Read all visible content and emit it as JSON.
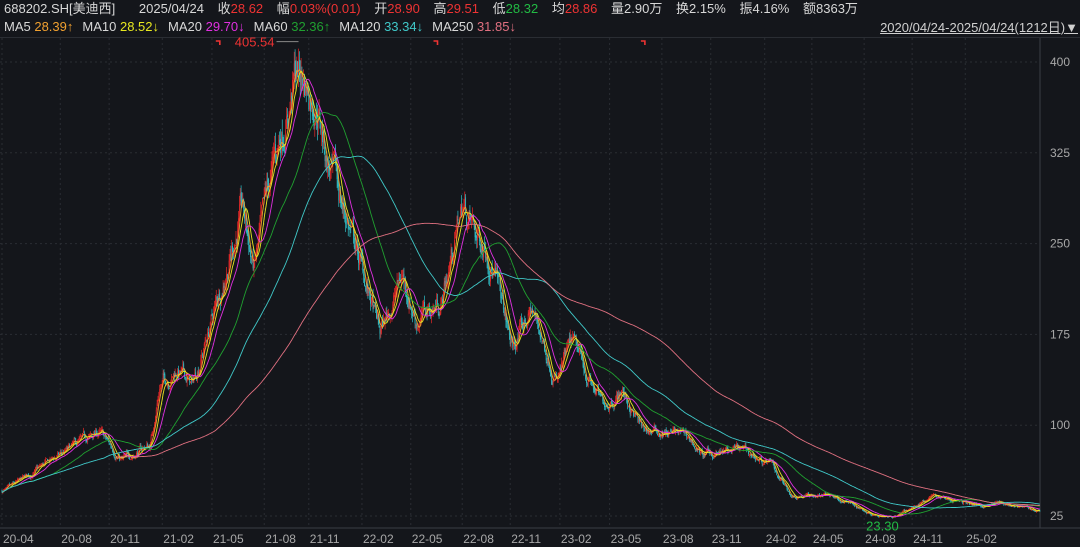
{
  "header": {
    "symbol": "688202.SH[美迪西]",
    "date": "2025/04/24",
    "close_label": "收",
    "close": "28.62",
    "change_label": "幅",
    "change": "0.03%(0.01)",
    "open_label": "开",
    "open": "28.90",
    "high_label": "高",
    "high": "29.51",
    "low_label": "低",
    "low": "28.32",
    "avg_label": "均",
    "avg": "28.86",
    "volume_label": "量",
    "volume": "2.90万",
    "turnover_label": "换",
    "turnover": "2.15%",
    "amplitude_label": "振",
    "amplitude": "4.16%",
    "amount_label": "额",
    "amount": "8363万",
    "range": "2020/04/24-2025/04/24(1212日)",
    "range_icon": "triangle-down-icon"
  },
  "ma": [
    {
      "name": "MA5",
      "value": "28.39↑",
      "color": "#f0a030",
      "period": 5
    },
    {
      "name": "MA10",
      "value": "28.52↓",
      "color": "#e8e820",
      "period": 10
    },
    {
      "name": "MA20",
      "value": "29.70↓",
      "color": "#e030e0",
      "period": 20
    },
    {
      "name": "MA60",
      "value": "32.36↑",
      "color": "#20a030",
      "period": 60
    },
    {
      "name": "MA120",
      "value": "33.34↓",
      "color": "#40c8c8",
      "period": 120
    },
    {
      "name": "MA250",
      "value": "31.85↓",
      "color": "#e07080",
      "period": 250
    }
  ],
  "colors": {
    "up": "#e82828",
    "down": "#30c0c8",
    "grid": "#2a2d33",
    "background": "#14161b"
  },
  "chart_data": {
    "type": "candlestick",
    "title": "688202.SH[美迪西] daily",
    "total_days": 1212,
    "ylim": [
      25,
      400
    ],
    "y_ticks": [
      25,
      100,
      175,
      250,
      325,
      400
    ],
    "y_tick_labels": [
      "25",
      "100",
      "175",
      "250",
      "325",
      "400"
    ],
    "x_ticks": [
      {
        "label": "20-04",
        "day": 0
      },
      {
        "label": "20-08",
        "day": 68
      },
      {
        "label": "20-11",
        "day": 125
      },
      {
        "label": "21-02",
        "day": 187
      },
      {
        "label": "21-05",
        "day": 245
      },
      {
        "label": "21-08",
        "day": 306
      },
      {
        "label": "21-11",
        "day": 358
      },
      {
        "label": "22-02",
        "day": 420
      },
      {
        "label": "22-05",
        "day": 477
      },
      {
        "label": "22-08",
        "day": 537
      },
      {
        "label": "22-11",
        "day": 593
      },
      {
        "label": "23-02",
        "day": 651
      },
      {
        "label": "23-05",
        "day": 709
      },
      {
        "label": "23-08",
        "day": 770
      },
      {
        "label": "23-11",
        "day": 827
      },
      {
        "label": "24-02",
        "day": 890
      },
      {
        "label": "24-05",
        "day": 945
      },
      {
        "label": "24-08",
        "day": 1006
      },
      {
        "label": "24-11",
        "day": 1062
      },
      {
        "label": "25-02",
        "day": 1124
      }
    ],
    "close_path": [
      [
        0,
        46
      ],
      [
        6,
        46
      ],
      [
        58,
        71
      ],
      [
        113,
        94
      ],
      [
        140,
        71
      ],
      [
        173,
        84
      ],
      [
        184,
        133
      ],
      [
        204,
        146
      ],
      [
        222,
        133
      ],
      [
        245,
        187
      ],
      [
        280,
        278
      ],
      [
        294,
        228
      ],
      [
        321,
        327
      ],
      [
        344,
        393
      ],
      [
        368,
        369
      ],
      [
        379,
        319
      ],
      [
        403,
        270
      ],
      [
        420,
        228
      ],
      [
        441,
        175
      ],
      [
        467,
        224
      ],
      [
        484,
        187
      ],
      [
        513,
        203
      ],
      [
        537,
        282
      ],
      [
        554,
        253
      ],
      [
        566,
        253
      ],
      [
        595,
        162
      ],
      [
        618,
        195
      ],
      [
        648,
        137
      ],
      [
        665,
        166
      ],
      [
        700,
        117
      ],
      [
        723,
        129
      ],
      [
        747,
        96
      ],
      [
        799,
        92
      ],
      [
        817,
        75
      ],
      [
        863,
        79
      ],
      [
        898,
        67
      ],
      [
        922,
        42
      ],
      [
        968,
        42
      ],
      [
        1015,
        27
      ],
      [
        1044,
        25
      ],
      [
        1068,
        34
      ],
      [
        1085,
        42
      ],
      [
        1138,
        34
      ],
      [
        1167,
        36
      ],
      [
        1211,
        28.62
      ]
    ],
    "annotations": {
      "max": "405.54",
      "min": "23.30"
    },
    "markers": [
      {
        "day": 253
      },
      {
        "day": 507
      },
      {
        "day": 749
      }
    ]
  }
}
